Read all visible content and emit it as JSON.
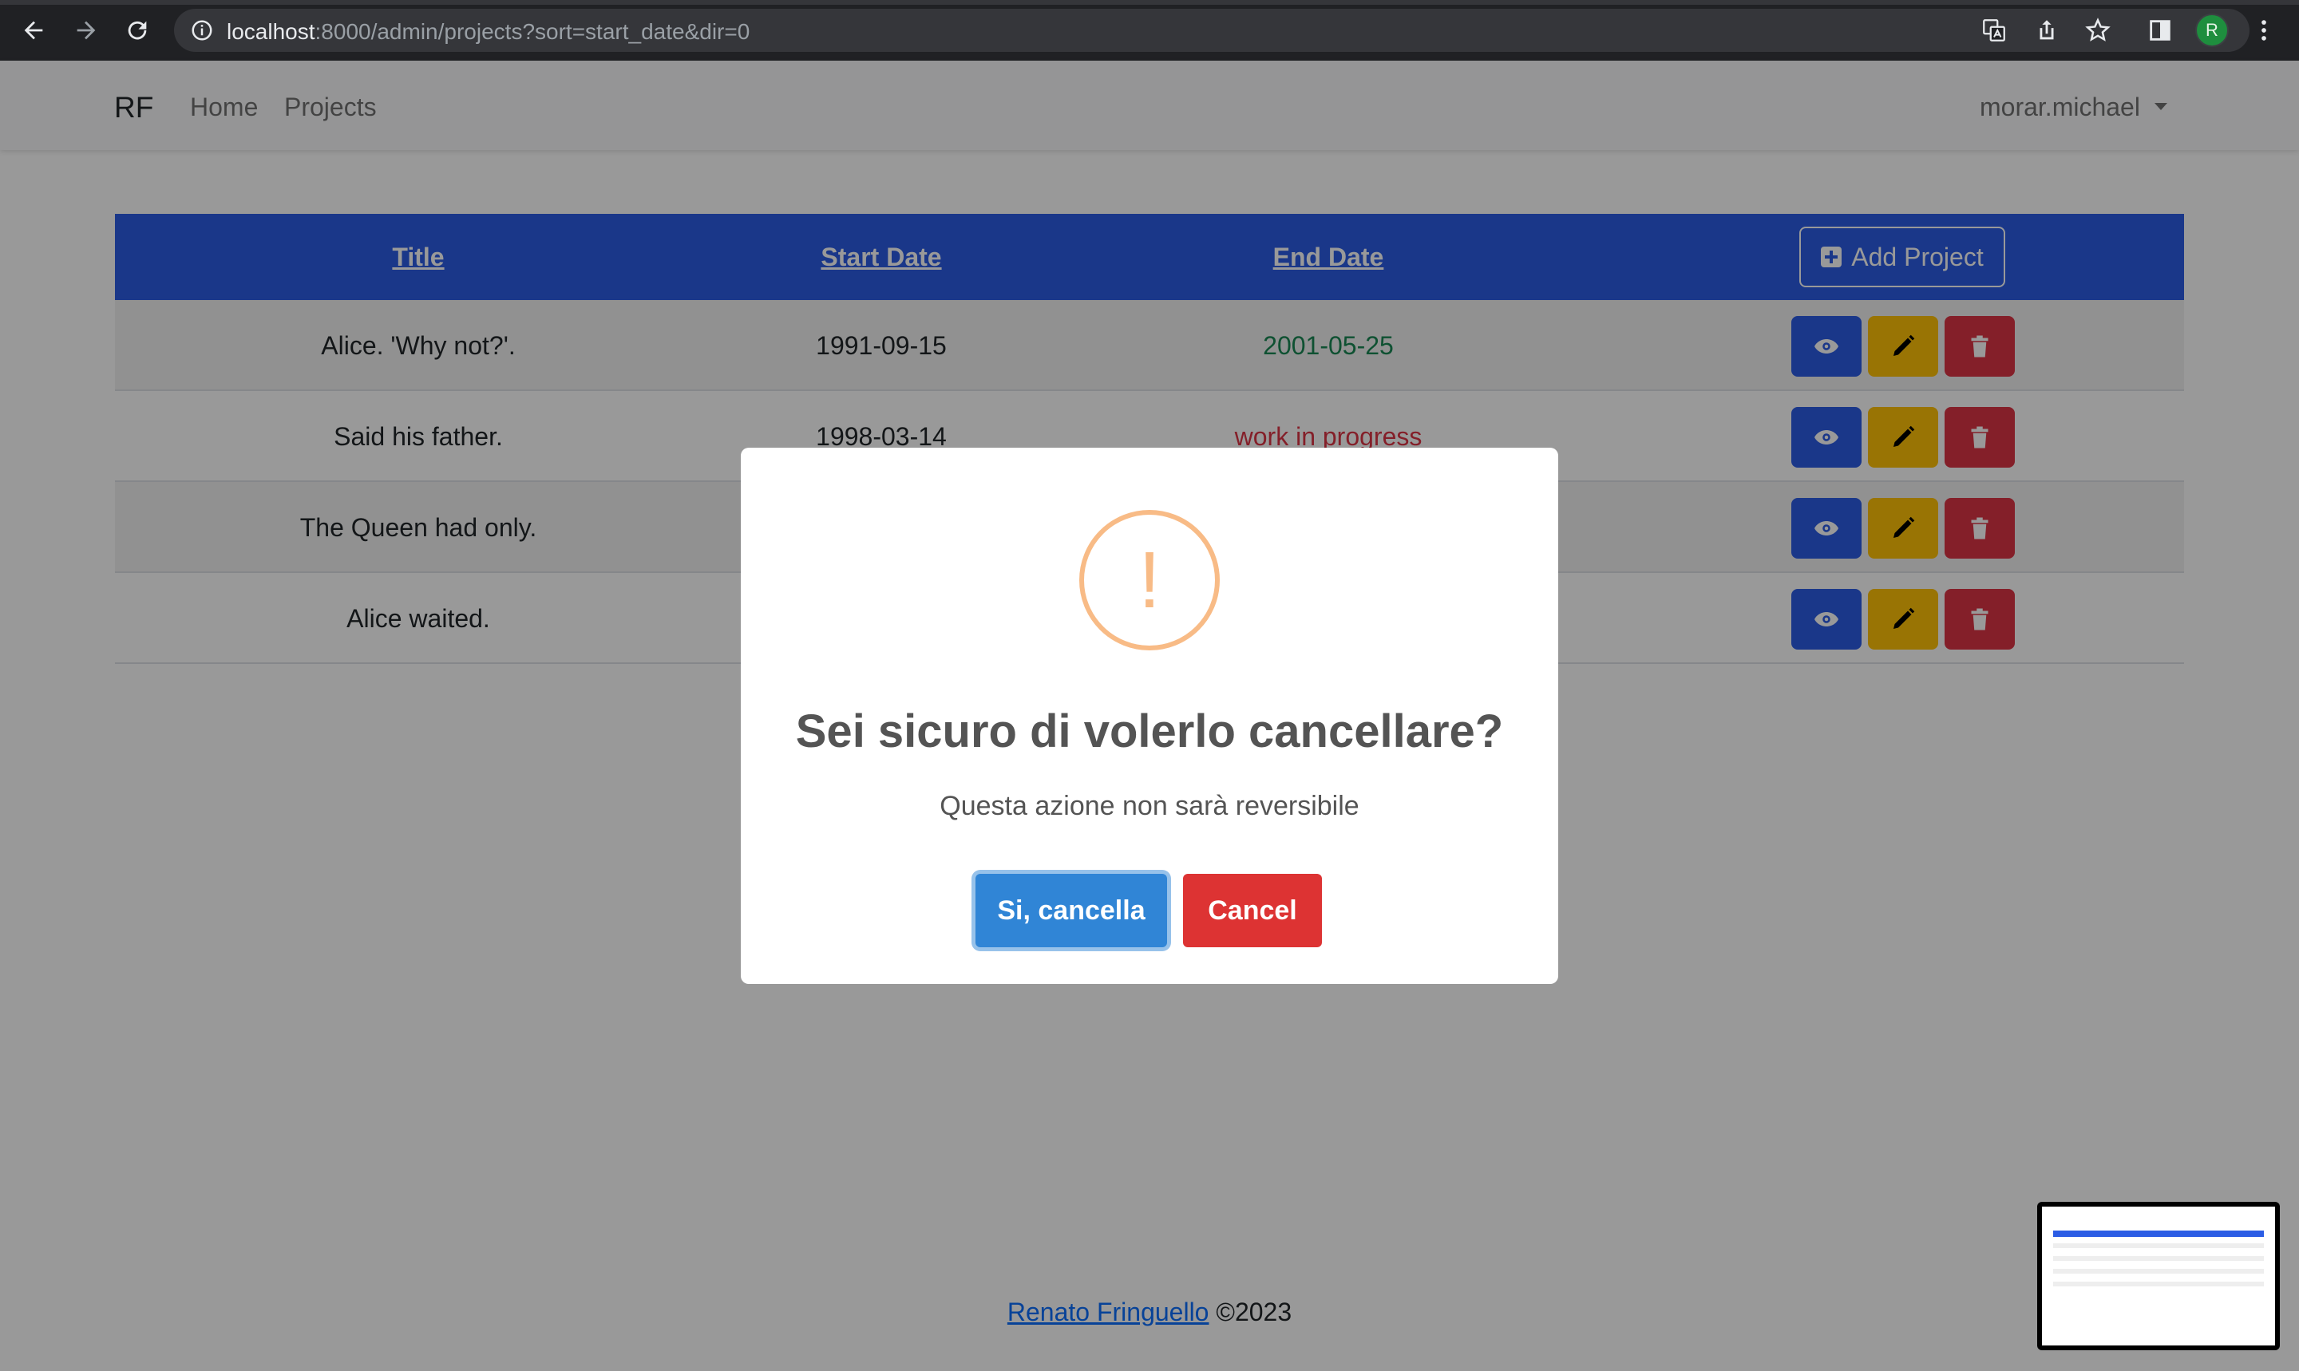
{
  "browser": {
    "url_host": "localhost",
    "url_rest": ":8000/admin/projects?sort=start_date&dir=0",
    "profile_initial": "R"
  },
  "navbar": {
    "brand": "RF",
    "links": [
      "Home",
      "Projects"
    ],
    "user": "morar.michael"
  },
  "table": {
    "headers": [
      "Title",
      "Start Date",
      "End Date"
    ],
    "add_label": "Add Project",
    "rows": [
      {
        "title": "Alice. 'Why not?'.",
        "start": "1991-09-15",
        "end": "2001-05-25",
        "status": "done"
      },
      {
        "title": "Said his father.",
        "start": "1998-03-14",
        "end": "work in progress",
        "status": "wip"
      },
      {
        "title": "The Queen had only.",
        "start": "",
        "end": "",
        "status": "hidden"
      },
      {
        "title": "Alice waited.",
        "start": "",
        "end": "",
        "status": "hidden"
      }
    ]
  },
  "footer": {
    "author": "Renato Fringuello",
    "copyright": "©2023"
  },
  "modal": {
    "icon": "!",
    "title": "Sei sicuro di volerlo cancellare?",
    "text": "Questa azione non sarà reversibile",
    "confirm_label": "Si, cancella",
    "cancel_label": "Cancel"
  },
  "colors": {
    "primary": "#2c5de5",
    "warning": "#ffc107",
    "danger": "#dc3545",
    "success": "#198754",
    "swal_confirm": "#3085d6",
    "swal_cancel": "#dd3333"
  }
}
